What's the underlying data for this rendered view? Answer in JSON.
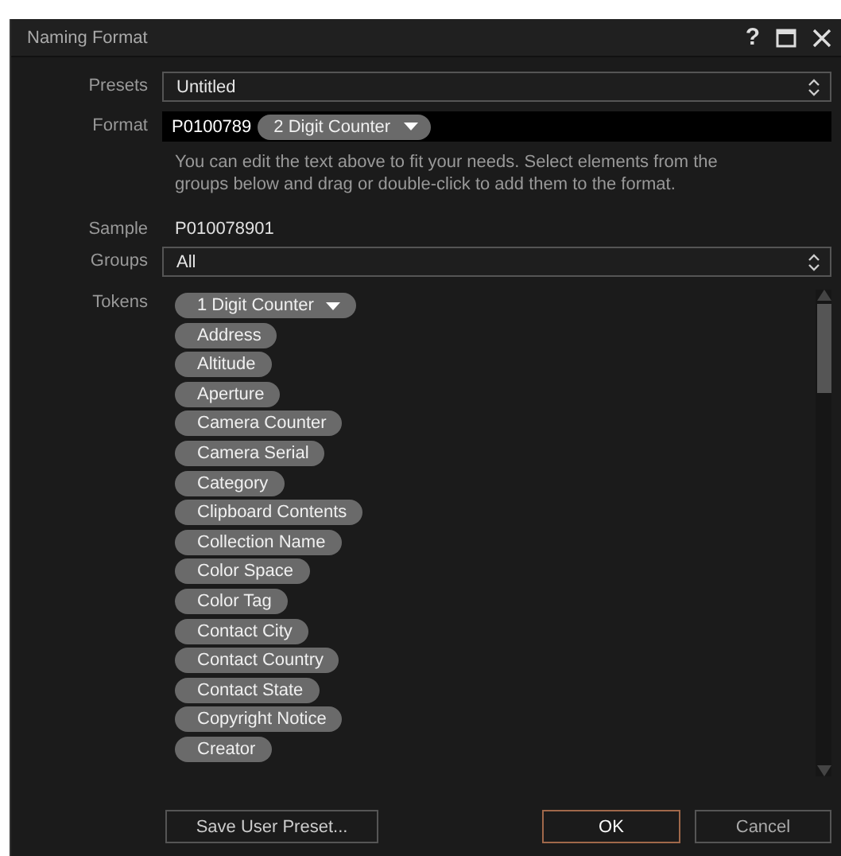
{
  "window": {
    "title": "Naming Format",
    "controls": [
      {
        "kind": "help",
        "label": "?"
      },
      {
        "kind": "maximize"
      },
      {
        "kind": "close"
      }
    ]
  },
  "presets": {
    "label": "Presets",
    "value": "Untitled"
  },
  "format": {
    "label": "Format",
    "text": "P0100789",
    "token": {
      "label": "2 Digit Counter",
      "menu": true
    }
  },
  "help_text": "You can edit the text above to fit your needs. Select elements from the groups below and drag or double-click to add them to the format.",
  "sample": {
    "label": "Sample",
    "value": "P010078901"
  },
  "groups": {
    "label": "Groups",
    "value": "All"
  },
  "tokens": {
    "label": "Tokens",
    "items": [
      {
        "label": "1 Digit Counter",
        "menu": true
      },
      {
        "label": "Address",
        "menu": false
      },
      {
        "label": "Altitude",
        "menu": false
      },
      {
        "label": "Aperture",
        "menu": false
      },
      {
        "label": "Camera Counter",
        "menu": false
      },
      {
        "label": "Camera Serial",
        "menu": false
      },
      {
        "label": "Category",
        "menu": false
      },
      {
        "label": "Clipboard Contents",
        "menu": false
      },
      {
        "label": "Collection Name",
        "menu": false
      },
      {
        "label": "Color Space",
        "menu": false
      },
      {
        "label": "Color Tag",
        "menu": false
      },
      {
        "label": "Contact City",
        "menu": false
      },
      {
        "label": "Contact Country",
        "menu": false
      },
      {
        "label": "Contact State",
        "menu": false
      },
      {
        "label": "Copyright Notice",
        "menu": false
      },
      {
        "label": "Creator",
        "menu": false
      }
    ]
  },
  "buttons": [
    {
      "label": "Save User Preset...",
      "kind": "secondary"
    },
    {
      "label": "OK",
      "kind": "default"
    },
    {
      "label": "Cancel",
      "kind": "normal"
    }
  ]
}
